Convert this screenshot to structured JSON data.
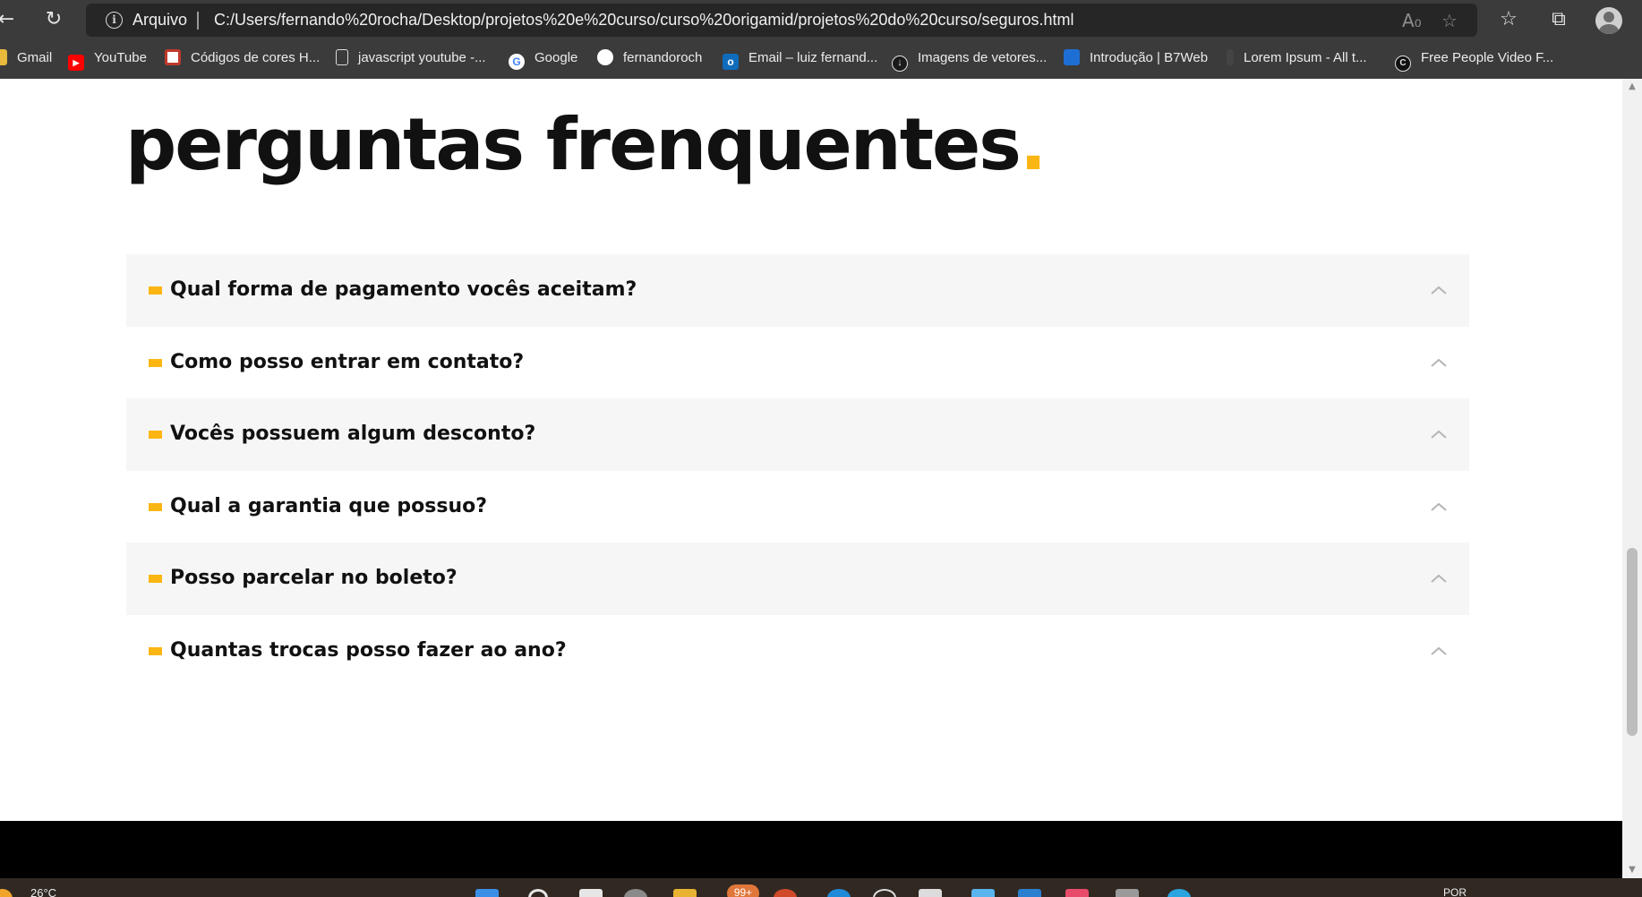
{
  "browser": {
    "site_info_label": "Arquivo",
    "url": "C:/Users/fernando%20rocha/Desktop/projetos%20e%20curso/curso%20origamid/projetos%20do%20curso/seguros.html",
    "bookmarks": [
      {
        "label": "Gmail",
        "icon": "gmail-icon",
        "color": "#e8b93a"
      },
      {
        "label": "YouTube",
        "icon": "youtube-icon",
        "color": "#ff0000"
      },
      {
        "label": "Códigos de cores H...",
        "icon": "color-codes-icon",
        "color": "#c0392b"
      },
      {
        "label": "javascript youtube -...",
        "icon": "page-icon",
        "color": "#dcdcdc"
      },
      {
        "label": "Google",
        "icon": "google-icon",
        "color": "#4285f4"
      },
      {
        "label": "fernandoroch",
        "icon": "github-icon",
        "color": "#ffffff"
      },
      {
        "label": "Email – luiz fernand...",
        "icon": "outlook-icon",
        "color": "#0f6cbd"
      },
      {
        "label": "Imagens de vetores...",
        "icon": "download-icon",
        "color": "#1a1a1a"
      },
      {
        "label": "Introdução | B7Web",
        "icon": "b7web-icon",
        "color": "#1d6fd6"
      },
      {
        "label": "Lorem Ipsum - All t...",
        "icon": "lorem-icon",
        "color": "#444444"
      },
      {
        "label": "Free People Video F...",
        "icon": "coverr-icon",
        "color": "#111111"
      }
    ]
  },
  "page": {
    "heading_text": "perguntas frenquentes",
    "heading_dot": ".",
    "accent_color": "#fbb614",
    "faq": [
      {
        "question": "Qual forma de pagamento vocês aceitam?"
      },
      {
        "question": "Como posso entrar em contato?"
      },
      {
        "question": "Vocês possuem algum desconto?"
      },
      {
        "question": "Qual a garantia que possuo?"
      },
      {
        "question": "Posso parcelar no boleto?"
      },
      {
        "question": "Quantas trocas posso fazer ao ano?"
      }
    ]
  },
  "taskbar": {
    "temperature": "26°C",
    "notification_badge": "99+",
    "language": "POR"
  }
}
